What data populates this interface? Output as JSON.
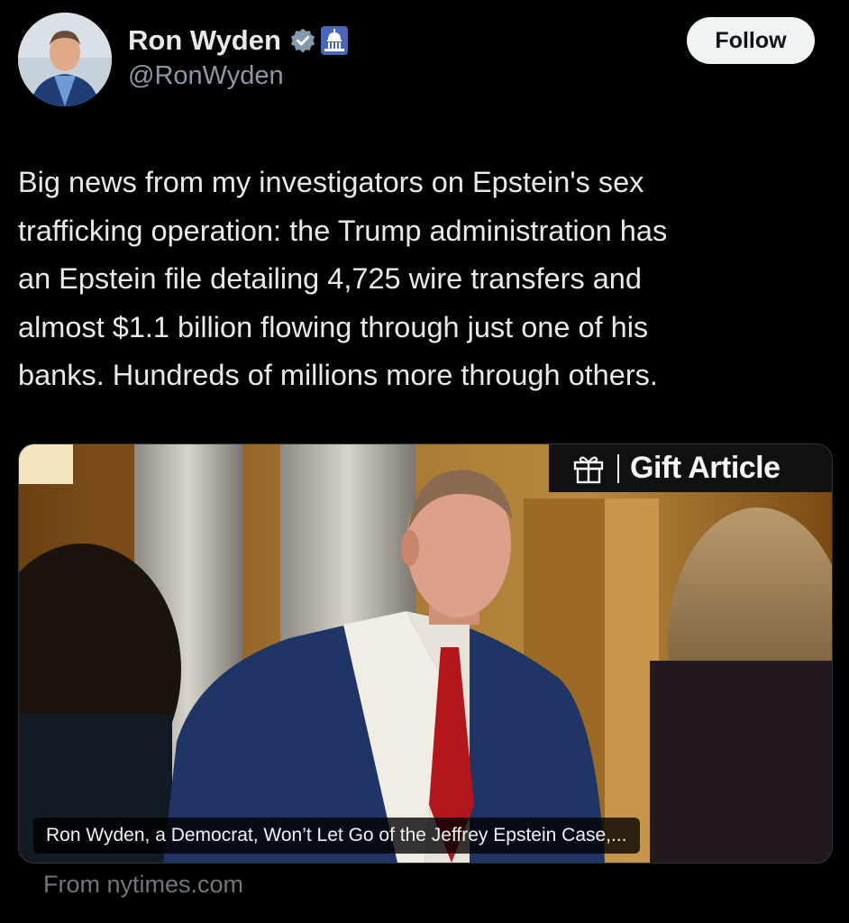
{
  "author": {
    "name": "Ron Wyden",
    "handle": "@RonWyden",
    "verified_badge_icon": "verified-check-icon",
    "affiliation_icon": "capitol-building-icon",
    "badge_color": "#829aab"
  },
  "follow_button": {
    "label": "Follow"
  },
  "tweet": {
    "lines": [
      "Big news from my investigators on Epstein's sex",
      "trafficking operation: the Trump administration has",
      "an Epstein file detailing 4,725 wire transfers and",
      "almost $1.1 billion flowing through just one of his",
      "banks. Hundreds of millions more through others."
    ]
  },
  "link_card": {
    "gift_label": "Gift Article",
    "gift_icon": "gift-icon",
    "caption": "Ron Wyden, a Democrat, Won’t Let Go of the Jeffrey Epstein Case,...",
    "source": "From nytimes.com"
  },
  "colors": {
    "background": "#000000",
    "text": "#e7e9ea",
    "secondary_text": "#8b98a5",
    "follow_bg": "#eff3f4"
  }
}
